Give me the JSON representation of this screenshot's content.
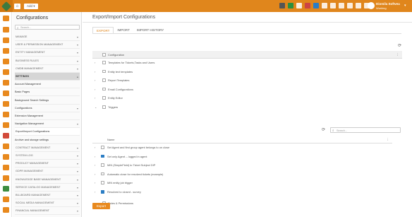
{
  "topbar": {
    "home_icon": "home-icon",
    "add_label": "Add",
    "icons": [
      "monitor-icon",
      "flag-icon",
      "clock-icon",
      "list-icon",
      "search-icon",
      "headset-icon",
      "tag-icon",
      "heart-icon",
      "calendar-icon",
      "chat-icon",
      "mail-icon"
    ],
    "user": {
      "name": "Diomila Softvea",
      "status": "Working"
    }
  },
  "rail": {
    "icons": [
      "calendar-icon",
      "grid-icon",
      "clipboard-icon",
      "cart-icon",
      "layers-icon",
      "person-icon",
      "search-icon",
      "chart-icon",
      "chat-icon",
      "megaphone-icon",
      "chart-bar-icon",
      "document-icon",
      "block-icon",
      "calendar-icon",
      "shield-icon",
      "tools-icon",
      "puzzle-icon",
      "settings-icon"
    ]
  },
  "config": {
    "title": "Configurations",
    "search_placeholder": "Search...",
    "items": [
      {
        "label": "MANAGE",
        "kind": "head",
        "chev": "▾"
      },
      {
        "label": "USER & PERMISSION MANAGEMENT",
        "kind": "head",
        "chev": "▾"
      },
      {
        "label": "ENTITY MANAGEMENT",
        "kind": "head",
        "chev": "▾"
      },
      {
        "label": "BUSINESS RULES",
        "kind": "head",
        "chev": "▾"
      },
      {
        "label": "CMDB MANAGEMENT",
        "kind": "head",
        "chev": "▾"
      },
      {
        "label": "SETTINGS",
        "kind": "active",
        "chev": "▴"
      },
      {
        "label": "Account Management",
        "kind": "sub",
        "chev": ""
      },
      {
        "label": "Basic Pages",
        "kind": "sub",
        "chev": ""
      },
      {
        "label": "Background Search Settings",
        "kind": "sub",
        "chev": ""
      },
      {
        "label": "Configurations",
        "kind": "sub",
        "chev": "▾"
      },
      {
        "label": "Extension Management",
        "kind": "sub",
        "chev": ""
      },
      {
        "label": "Navigation Management",
        "kind": "sub",
        "chev": "▾"
      },
      {
        "label": "Export/Import Configurations",
        "kind": "selected",
        "chev": ""
      },
      {
        "label": "Archive and storage settings",
        "kind": "sub",
        "chev": ""
      },
      {
        "label": "CONTRACT MANAGEMENT",
        "kind": "head",
        "chev": "▾"
      },
      {
        "label": "SYSTEM LOG",
        "kind": "head",
        "chev": "▾"
      },
      {
        "label": "PRODUCT MANAGEMENT",
        "kind": "head",
        "chev": "▾"
      },
      {
        "label": "GDPR MANAGEMENT",
        "kind": "head",
        "chev": "▾"
      },
      {
        "label": "KNOWLEDGE BASE MANAGEMENT",
        "kind": "head",
        "chev": "▾"
      },
      {
        "label": "SERVICE CATALOG MANAGEMENT",
        "kind": "head",
        "chev": "▾"
      },
      {
        "label": "BILLBOARD MANAGEMENT",
        "kind": "head",
        "chev": "▾"
      },
      {
        "label": "SOCIAL MEDIA MANAGEMENT",
        "kind": "head",
        "chev": "▾"
      },
      {
        "label": "FINANCIAL MANAGEMENT",
        "kind": "head",
        "chev": "▾"
      }
    ]
  },
  "main": {
    "title": "Export/Import Configurations",
    "tabs": [
      "EXPORT",
      "IMPORT",
      "IMPORT HISTORY"
    ],
    "tree_header": "Configuration",
    "tree": [
      {
        "label": "Templates for Tickets,Tasks and Users",
        "toggle": "›",
        "checked": false
      },
      {
        "label": "Entity text templates",
        "toggle": "›",
        "checked": false
      },
      {
        "label": "Report Templates",
        "toggle": "›",
        "checked": false
      },
      {
        "label": "Email Configurations",
        "toggle": "›",
        "checked": false
      },
      {
        "label": "Entity Editor",
        "toggle": "›",
        "checked": false
      },
      {
        "label": "Triggers",
        "toggle": "⌄",
        "checked": false
      }
    ],
    "inner_search_placeholder": "Search...",
    "inner_header": "Name",
    "inner_rows": [
      {
        "label": "Set Agent and first group agent belongs to on close",
        "checked": false
      },
      {
        "label": "Set only Agent -- logged in agent",
        "checked": true
      },
      {
        "label": "MIN (SimpleField) to Ticket Subject DIP",
        "checked": false
      },
      {
        "label": "Automatic close for resolved tickets (example)",
        "checked": false
      },
      {
        "label": "MIN entity job trigger",
        "checked": false
      },
      {
        "label": "Resolved to closed - survey",
        "checked": true
      }
    ],
    "last_row": {
      "label": "Roles & Permissions",
      "toggle": "›",
      "checked": false
    },
    "export_button": "Export"
  }
}
